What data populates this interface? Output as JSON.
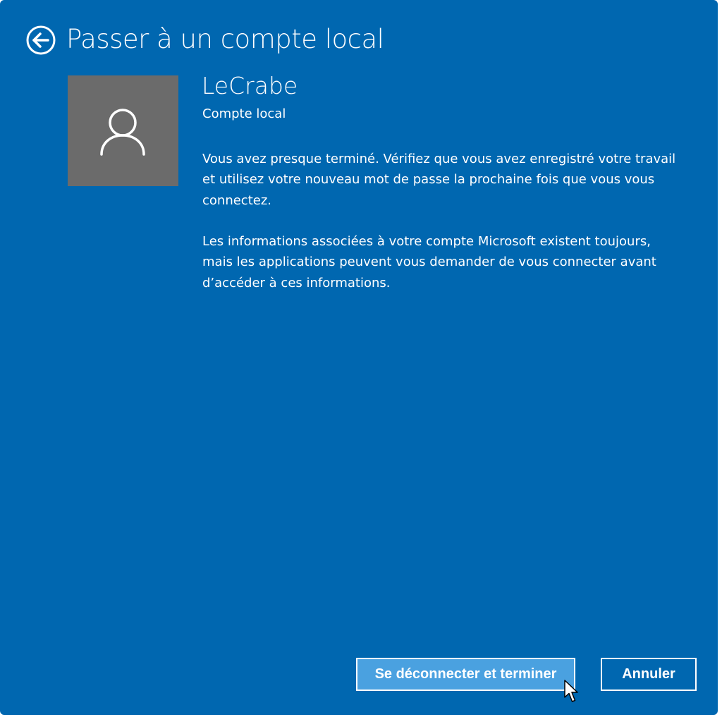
{
  "page": {
    "title": "Passer à un compte local",
    "back_icon": "back-arrow-icon"
  },
  "account": {
    "name": "LeCrabe",
    "type": "Compte local",
    "avatar_icon": "user-silhouette-icon"
  },
  "messages": {
    "paragraph1": "Vous avez presque terminé. Vérifiez que vous avez enregistré votre travail et utilisez votre nouveau mot de passe la prochaine fois que vous vous connectez.",
    "paragraph2": "Les informations associées à votre compte Microsoft existent toujours, mais les applications peuvent vous demander de vous connecter avant d’accéder à ces informations."
  },
  "buttons": {
    "primary_label": "Se déconnecter et terminer",
    "cancel_label": "Annuler"
  },
  "colors": {
    "background": "#0067b0",
    "avatar_background": "#6b6b6b",
    "primary_button": "#4aa1e0",
    "text": "#ffffff"
  }
}
